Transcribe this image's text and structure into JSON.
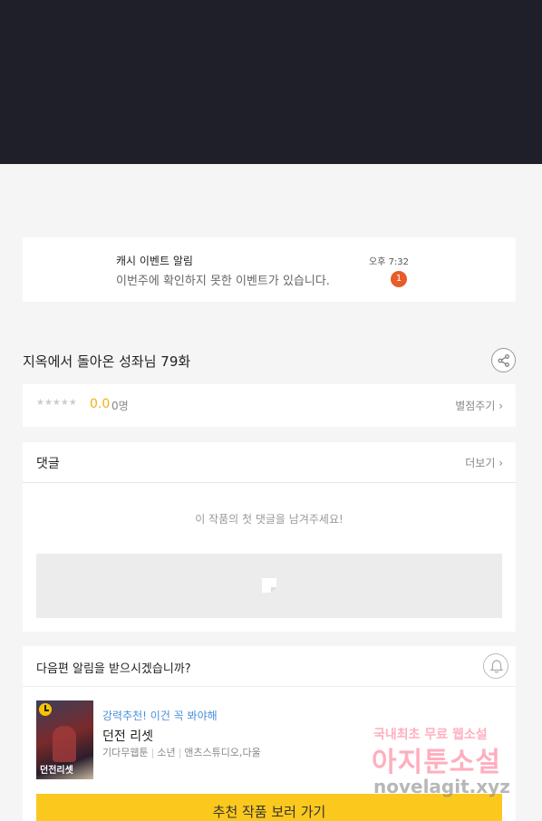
{
  "notification": {
    "title": "캐시 이벤트 알림",
    "message": "이번주에 확인하지 못한 이벤트가 있습니다.",
    "time": "오후 7:32",
    "badge": "1"
  },
  "episode": {
    "title": "지옥에서 돌아온 성좌님 79화",
    "share_icon": "share-icon"
  },
  "rating": {
    "stars": "★★★★★",
    "score": "0.0",
    "count": "0명",
    "rate_link": "별점주기 ›"
  },
  "comments": {
    "title": "댓글",
    "more": "더보기 ›",
    "empty": "이 작품의 첫 댓글을 남겨주세요!",
    "write_icon": "pencil-icon"
  },
  "next_alert": {
    "question": "다음편 알림을 받으시겠습니까?",
    "bell_icon": "bell-icon",
    "recommend_tag": "강력추천! 이건 꼭 봐야해",
    "recommend_title": "던전 리셋",
    "meta": [
      "기다무웹툰",
      "소년",
      "앤츠스튜디오,다울"
    ],
    "thumb_caption": "던전리셋",
    "button": "추천 작품 보러 가기"
  },
  "watermark": {
    "line1": "국내최초 무료 웹소설",
    "line2": "아지툰소설",
    "line3": "novelagit.xyz"
  },
  "colors": {
    "top_band": "#1f1f29",
    "accent_yellow": "#fbc81d",
    "badge_orange": "#e85c2a",
    "tag_blue": "#4a90d9"
  }
}
